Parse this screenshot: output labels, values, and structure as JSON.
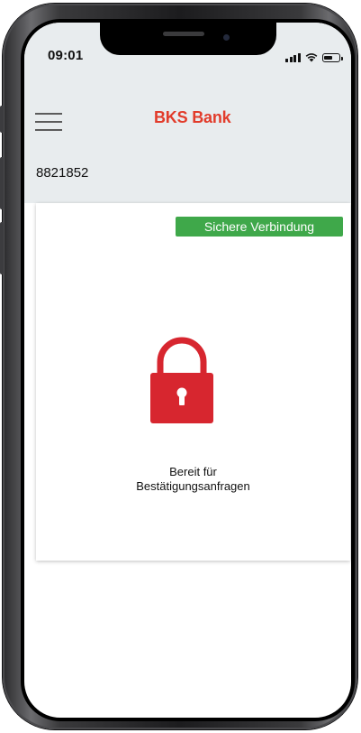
{
  "status_bar": {
    "time": "09:01",
    "icons": [
      "signal-icon",
      "wifi-icon",
      "battery-icon"
    ]
  },
  "header": {
    "menu_icon": "hamburger-menu-icon",
    "brand": "BKS Bank",
    "brand_color": "#e23c2b"
  },
  "account": {
    "number": "8821852"
  },
  "card": {
    "badge": "Sichere Verbindung",
    "badge_color": "#3fa84a",
    "lock_icon": "lock-icon",
    "lock_color": "#d7262f",
    "status_line1": "Bereit für",
    "status_line2": "Bestätigungsanfragen"
  }
}
